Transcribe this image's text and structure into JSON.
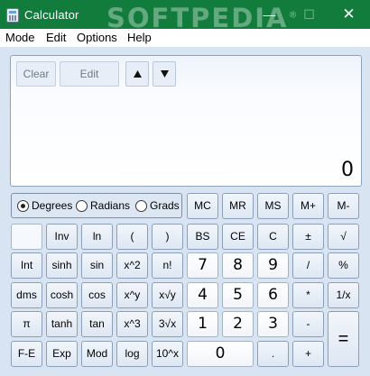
{
  "window": {
    "title": "Calculator",
    "watermark": "SOFTPEDIA",
    "watermark_mark": "®",
    "controls": {
      "minimize": "—",
      "maximize": "☐",
      "close": "✕"
    }
  },
  "menu": [
    "Mode",
    "Edit",
    "Options",
    "Help"
  ],
  "display": {
    "clear_label": "Clear",
    "edit_label": "Edit",
    "up_icon": "arrow-up",
    "down_icon": "arrow-down",
    "value": "0"
  },
  "angle_mode": {
    "options": [
      "Degrees",
      "Radians",
      "Grads"
    ],
    "selected": "Degrees"
  },
  "memory_keys": [
    "MC",
    "MR",
    "MS",
    "M+",
    "M-"
  ],
  "scientific_keys": [
    [
      "",
      "Inv",
      "ln",
      "(",
      ")"
    ],
    [
      "Int",
      "sinh",
      "sin",
      "x^2",
      "n!"
    ],
    [
      "dms",
      "cosh",
      "cos",
      "x^y",
      "x√y"
    ],
    [
      "π",
      "tanh",
      "tan",
      "x^3",
      "3√x"
    ],
    [
      "F-E",
      "Exp",
      "Mod",
      "log",
      "10^x"
    ]
  ],
  "standard_keys": [
    [
      "BS",
      "CE",
      "C",
      "±",
      "√"
    ],
    [
      "7",
      "8",
      "9",
      "/",
      "%"
    ],
    [
      "4",
      "5",
      "6",
      "*",
      "1/x"
    ],
    [
      "1",
      "2",
      "3",
      "-",
      "="
    ],
    [
      "0",
      ".",
      "+"
    ]
  ],
  "colors": {
    "titlebar": "#127c3c",
    "body": "#d8e4f2",
    "key_border": "#8d9fb8"
  }
}
